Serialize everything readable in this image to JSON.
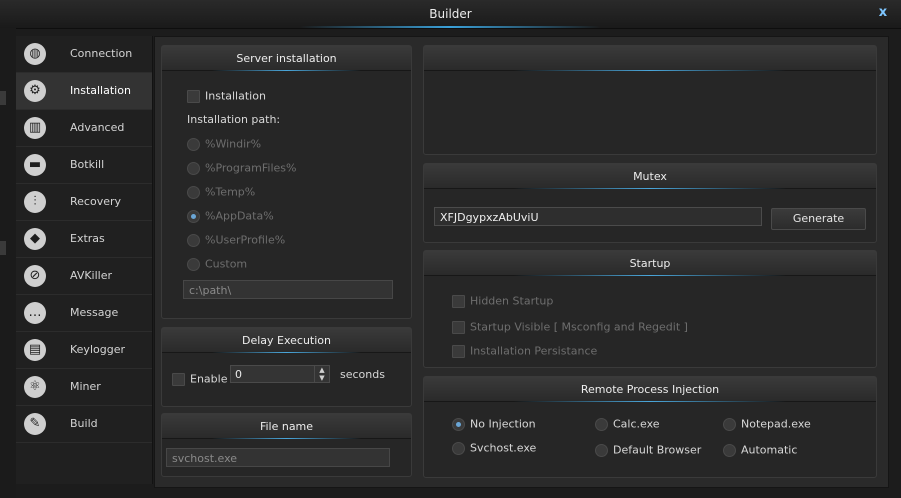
{
  "window": {
    "title": "Builder",
    "close_label": "x"
  },
  "sidebar": {
    "items": [
      {
        "label": "Connection",
        "icon": "globe-icon",
        "glyph": "◍"
      },
      {
        "label": "Installation",
        "icon": "gear-icon",
        "glyph": "⚙"
      },
      {
        "label": "Advanced",
        "icon": "map-icon",
        "glyph": "▥"
      },
      {
        "label": "Botkill",
        "icon": "minus-circle-icon",
        "glyph": "▬"
      },
      {
        "label": "Recovery",
        "icon": "sliders-icon",
        "glyph": "⫶"
      },
      {
        "label": "Extras",
        "icon": "layers-icon",
        "glyph": "◆"
      },
      {
        "label": "AVKiller",
        "icon": "block-icon",
        "glyph": "⊘"
      },
      {
        "label": "Message",
        "icon": "chat-bubble-icon",
        "glyph": "…"
      },
      {
        "label": "Keylogger",
        "icon": "keyboard-icon",
        "glyph": "▤"
      },
      {
        "label": "Miner",
        "icon": "atom-icon",
        "glyph": "⚛"
      },
      {
        "label": "Build",
        "icon": "edit-icon",
        "glyph": "✎"
      }
    ],
    "active": "Installation"
  },
  "server_installation": {
    "title": "Server installation",
    "checkbox_label": "Installation",
    "path_label": "Installation path:",
    "options": [
      "%Windir%",
      "%ProgramFiles%",
      "%Temp%",
      "%AppData%",
      "%UserProfile%",
      "Custom"
    ],
    "selected": "%AppData%",
    "custom_path": "c:\\path\\"
  },
  "delay_execution": {
    "title": "Delay Execution",
    "enable_label": "Enable",
    "value": "0",
    "unit": "seconds"
  },
  "file_name": {
    "title": "File name",
    "value": "svchost.exe"
  },
  "mutex": {
    "title": "Mutex",
    "value": "XFJDgypxzAbUviU",
    "generate_label": "Generate"
  },
  "startup": {
    "title": "Startup",
    "options": [
      "Hidden Startup",
      "Startup Visible [ Msconfig and Regedit ]",
      "Installation Persistance"
    ]
  },
  "injection": {
    "title": "Remote Process Injection",
    "options": [
      "No Injection",
      "Calc.exe",
      "Notepad.exe",
      "Svchost.exe",
      "Default Browser",
      "Automatic"
    ],
    "selected": "No Injection"
  },
  "colors": {
    "accent": "#4aa6da",
    "background": "#1c1c1c",
    "panel": "#262626"
  }
}
